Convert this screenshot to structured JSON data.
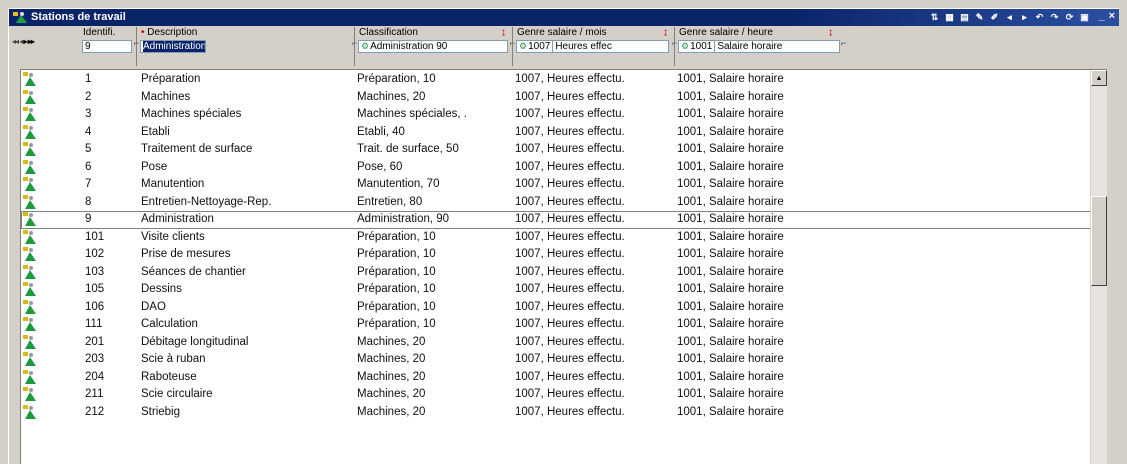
{
  "window": {
    "title": "Stations de travail",
    "toolbar_icons": [
      "sort-icon",
      "table-icon",
      "table-icon",
      "edit-icon",
      "edit-icon",
      "arrow-left-icon",
      "arrow-right-icon",
      "undo-icon",
      "redo-icon",
      "refresh-icon",
      "save-icon"
    ],
    "minimize_label": "_",
    "close_label": "×"
  },
  "nav": {
    "first": "◂◂",
    "prev": "◂",
    "next": "▸",
    "last": "▸▸"
  },
  "columns": {
    "id": {
      "label": "Identifi.",
      "filter": "9"
    },
    "desc": {
      "required_mark": "•",
      "label": "Description",
      "filter": "Administration"
    },
    "class": {
      "label": "Classification",
      "sort_mark": "↨",
      "filter": "Administration",
      "filter_code": "90"
    },
    "gm": {
      "label": "Genre salaire / mois",
      "sort_mark": "↨",
      "filter_code": "1007",
      "filter": "Heures effec"
    },
    "gh": {
      "label": "Genre salaire / heure",
      "sort_mark": "↨",
      "filter_code": "1001",
      "filter": "Salaire horaire"
    }
  },
  "rows": [
    {
      "id": "1",
      "desc": "Préparation",
      "class": "Préparation, 10",
      "gm": "1007, Heures effectu.",
      "gh": "1001, Salaire horaire"
    },
    {
      "id": "2",
      "desc": "Machines",
      "class": "Machines, 20",
      "gm": "1007, Heures effectu.",
      "gh": "1001, Salaire horaire"
    },
    {
      "id": "3",
      "desc": "Machines spéciales",
      "class": "Machines spéciales, .",
      "gm": "1007, Heures effectu.",
      "gh": "1001, Salaire horaire"
    },
    {
      "id": "4",
      "desc": "Etabli",
      "class": "Etabli, 40",
      "gm": "1007, Heures effectu.",
      "gh": "1001, Salaire horaire"
    },
    {
      "id": "5",
      "desc": "Traitement de surface",
      "class": "Trait. de surface, 50",
      "gm": "1007, Heures effectu.",
      "gh": "1001, Salaire horaire"
    },
    {
      "id": "6",
      "desc": "Pose",
      "class": "Pose, 60",
      "gm": "1007, Heures effectu.",
      "gh": "1001, Salaire horaire"
    },
    {
      "id": "7",
      "desc": "Manutention",
      "class": "Manutention, 70",
      "gm": "1007, Heures effectu.",
      "gh": "1001, Salaire horaire"
    },
    {
      "id": "8",
      "desc": "Entretien-Nettoyage-Rep.",
      "class": "Entretien, 80",
      "gm": "1007, Heures effectu.",
      "gh": "1001, Salaire horaire"
    },
    {
      "id": "9",
      "desc": "Administration",
      "class": "Administration, 90",
      "gm": "1007, Heures effectu.",
      "gh": "1001, Salaire horaire"
    },
    {
      "id": "101",
      "desc": "Visite clients",
      "class": "Préparation, 10",
      "gm": "1007, Heures effectu.",
      "gh": "1001, Salaire horaire"
    },
    {
      "id": "102",
      "desc": "Prise de mesures",
      "class": "Préparation, 10",
      "gm": "1007, Heures effectu.",
      "gh": "1001, Salaire horaire"
    },
    {
      "id": "103",
      "desc": "Séances de chantier",
      "class": "Préparation, 10",
      "gm": "1007, Heures effectu.",
      "gh": "1001, Salaire horaire"
    },
    {
      "id": "105",
      "desc": "Dessins",
      "class": "Préparation, 10",
      "gm": "1007, Heures effectu.",
      "gh": "1001, Salaire horaire"
    },
    {
      "id": "106",
      "desc": "DAO",
      "class": "Préparation, 10",
      "gm": "1007, Heures effectu.",
      "gh": "1001, Salaire horaire"
    },
    {
      "id": "111",
      "desc": "Calculation",
      "class": "Préparation, 10",
      "gm": "1007, Heures effectu.",
      "gh": "1001, Salaire horaire"
    },
    {
      "id": "201",
      "desc": "Débitage longitudinal",
      "class": "Machines, 20",
      "gm": "1007, Heures effectu.",
      "gh": "1001, Salaire horaire"
    },
    {
      "id": "203",
      "desc": "Scie à ruban",
      "class": "Machines, 20",
      "gm": "1007, Heures effectu.",
      "gh": "1001, Salaire horaire"
    },
    {
      "id": "204",
      "desc": "Raboteuse",
      "class": "Machines, 20",
      "gm": "1007, Heures effectu.",
      "gh": "1001, Salaire horaire"
    },
    {
      "id": "211",
      "desc": "Scie circulaire",
      "class": "Machines, 20",
      "gm": "1007, Heures effectu.",
      "gh": "1001, Salaire horaire"
    },
    {
      "id": "212",
      "desc": "Striebig",
      "class": "Machines, 20",
      "gm": "1007, Heures effectu.",
      "gh": "1001, Salaire horaire"
    }
  ],
  "selected_row_id": "9",
  "colors": {
    "titlebar": "#0a246a",
    "window_bg": "#d4d0c8",
    "grid_bg": "#ffffff",
    "accent_red": "#c00000"
  }
}
